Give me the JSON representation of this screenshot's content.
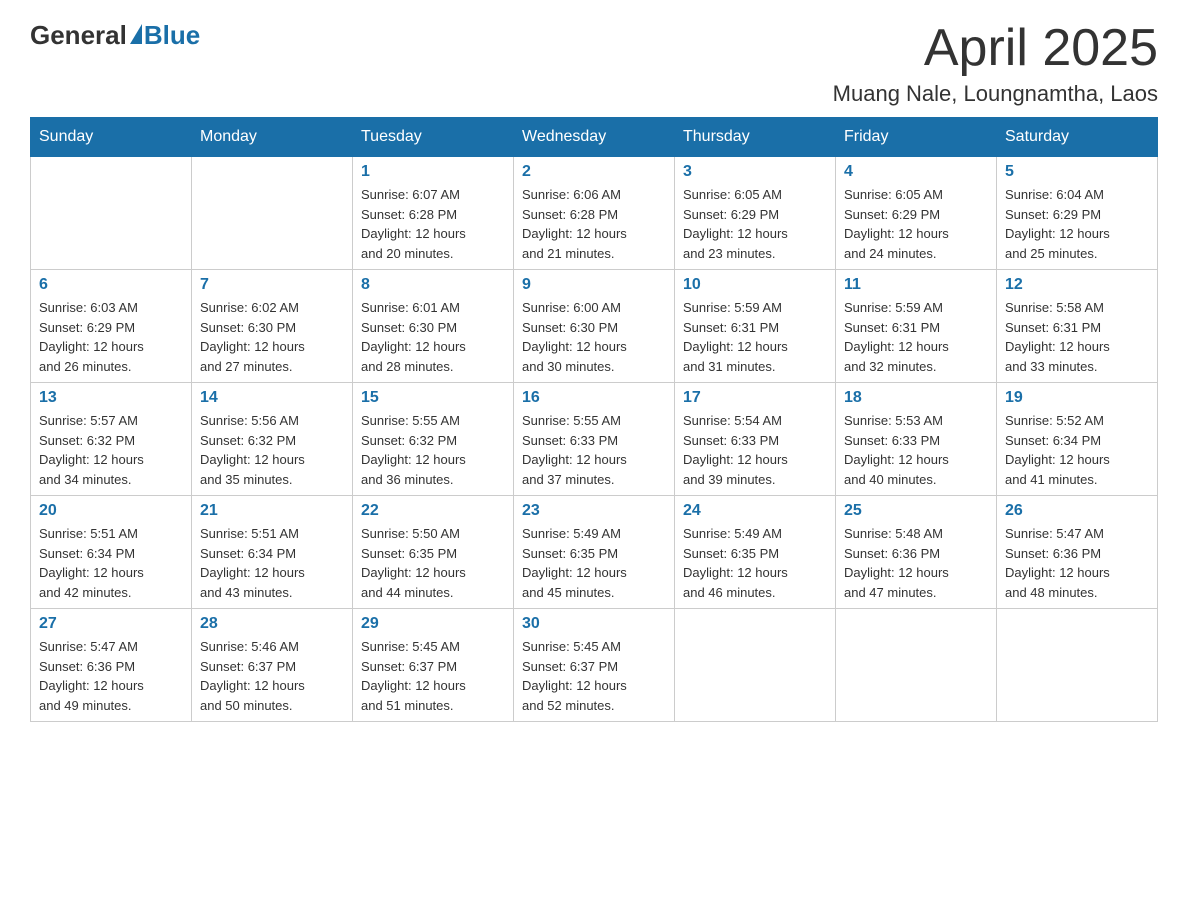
{
  "header": {
    "logo_general": "General",
    "logo_blue": "Blue",
    "month_title": "April 2025",
    "location": "Muang Nale, Loungnamtha, Laos"
  },
  "weekdays": [
    "Sunday",
    "Monday",
    "Tuesday",
    "Wednesday",
    "Thursday",
    "Friday",
    "Saturday"
  ],
  "weeks": [
    [
      null,
      null,
      {
        "day": 1,
        "sunrise": "6:07 AM",
        "sunset": "6:28 PM",
        "daylight": "12 hours and 20 minutes."
      },
      {
        "day": 2,
        "sunrise": "6:06 AM",
        "sunset": "6:28 PM",
        "daylight": "12 hours and 21 minutes."
      },
      {
        "day": 3,
        "sunrise": "6:05 AM",
        "sunset": "6:29 PM",
        "daylight": "12 hours and 23 minutes."
      },
      {
        "day": 4,
        "sunrise": "6:05 AM",
        "sunset": "6:29 PM",
        "daylight": "12 hours and 24 minutes."
      },
      {
        "day": 5,
        "sunrise": "6:04 AM",
        "sunset": "6:29 PM",
        "daylight": "12 hours and 25 minutes."
      }
    ],
    [
      {
        "day": 6,
        "sunrise": "6:03 AM",
        "sunset": "6:29 PM",
        "daylight": "12 hours and 26 minutes."
      },
      {
        "day": 7,
        "sunrise": "6:02 AM",
        "sunset": "6:30 PM",
        "daylight": "12 hours and 27 minutes."
      },
      {
        "day": 8,
        "sunrise": "6:01 AM",
        "sunset": "6:30 PM",
        "daylight": "12 hours and 28 minutes."
      },
      {
        "day": 9,
        "sunrise": "6:00 AM",
        "sunset": "6:30 PM",
        "daylight": "12 hours and 30 minutes."
      },
      {
        "day": 10,
        "sunrise": "5:59 AM",
        "sunset": "6:31 PM",
        "daylight": "12 hours and 31 minutes."
      },
      {
        "day": 11,
        "sunrise": "5:59 AM",
        "sunset": "6:31 PM",
        "daylight": "12 hours and 32 minutes."
      },
      {
        "day": 12,
        "sunrise": "5:58 AM",
        "sunset": "6:31 PM",
        "daylight": "12 hours and 33 minutes."
      }
    ],
    [
      {
        "day": 13,
        "sunrise": "5:57 AM",
        "sunset": "6:32 PM",
        "daylight": "12 hours and 34 minutes."
      },
      {
        "day": 14,
        "sunrise": "5:56 AM",
        "sunset": "6:32 PM",
        "daylight": "12 hours and 35 minutes."
      },
      {
        "day": 15,
        "sunrise": "5:55 AM",
        "sunset": "6:32 PM",
        "daylight": "12 hours and 36 minutes."
      },
      {
        "day": 16,
        "sunrise": "5:55 AM",
        "sunset": "6:33 PM",
        "daylight": "12 hours and 37 minutes."
      },
      {
        "day": 17,
        "sunrise": "5:54 AM",
        "sunset": "6:33 PM",
        "daylight": "12 hours and 39 minutes."
      },
      {
        "day": 18,
        "sunrise": "5:53 AM",
        "sunset": "6:33 PM",
        "daylight": "12 hours and 40 minutes."
      },
      {
        "day": 19,
        "sunrise": "5:52 AM",
        "sunset": "6:34 PM",
        "daylight": "12 hours and 41 minutes."
      }
    ],
    [
      {
        "day": 20,
        "sunrise": "5:51 AM",
        "sunset": "6:34 PM",
        "daylight": "12 hours and 42 minutes."
      },
      {
        "day": 21,
        "sunrise": "5:51 AM",
        "sunset": "6:34 PM",
        "daylight": "12 hours and 43 minutes."
      },
      {
        "day": 22,
        "sunrise": "5:50 AM",
        "sunset": "6:35 PM",
        "daylight": "12 hours and 44 minutes."
      },
      {
        "day": 23,
        "sunrise": "5:49 AM",
        "sunset": "6:35 PM",
        "daylight": "12 hours and 45 minutes."
      },
      {
        "day": 24,
        "sunrise": "5:49 AM",
        "sunset": "6:35 PM",
        "daylight": "12 hours and 46 minutes."
      },
      {
        "day": 25,
        "sunrise": "5:48 AM",
        "sunset": "6:36 PM",
        "daylight": "12 hours and 47 minutes."
      },
      {
        "day": 26,
        "sunrise": "5:47 AM",
        "sunset": "6:36 PM",
        "daylight": "12 hours and 48 minutes."
      }
    ],
    [
      {
        "day": 27,
        "sunrise": "5:47 AM",
        "sunset": "6:36 PM",
        "daylight": "12 hours and 49 minutes."
      },
      {
        "day": 28,
        "sunrise": "5:46 AM",
        "sunset": "6:37 PM",
        "daylight": "12 hours and 50 minutes."
      },
      {
        "day": 29,
        "sunrise": "5:45 AM",
        "sunset": "6:37 PM",
        "daylight": "12 hours and 51 minutes."
      },
      {
        "day": 30,
        "sunrise": "5:45 AM",
        "sunset": "6:37 PM",
        "daylight": "12 hours and 52 minutes."
      },
      null,
      null,
      null
    ]
  ],
  "labels": {
    "sunrise_prefix": "Sunrise: ",
    "sunset_prefix": "Sunset: ",
    "daylight_prefix": "Daylight: "
  }
}
